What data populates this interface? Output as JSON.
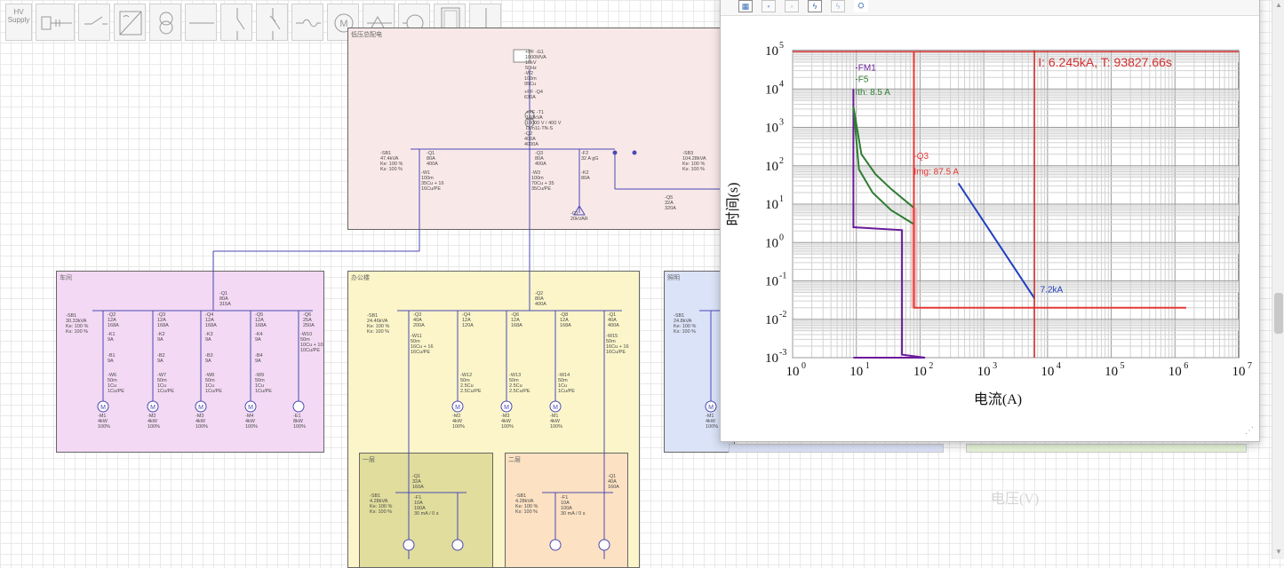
{
  "toolbar": {
    "hv_supply_label": "HV\nSupply",
    "items": [
      "hv-supply",
      "busbar",
      "disconnector",
      "converter",
      "transformer",
      "line",
      "switch",
      "breaker",
      "cable",
      "motor",
      "capacitor",
      "load",
      "panel",
      "earth"
    ]
  },
  "regions": {
    "top": {
      "title": "低压总配电"
    },
    "left": {
      "title": "车间"
    },
    "middle": {
      "title": "办公楼"
    },
    "right": {
      "title": "照明"
    },
    "sub1": {
      "title": "一层"
    },
    "sub2": {
      "title": "二层"
    }
  },
  "top_labels": {
    "source": "+PF -G1\n1000MVA\n10kV\n50Hz",
    "w2": "-W2\n100m\n95Cu",
    "q4": "+PF -Q4\n630A",
    "t1": "+PF -T1\n160kVA\n10000 V / 400 V\nDyn11-TN-S",
    "q2": "-Q2\n400A\n4000A",
    "sb1": "-SB1\n47.4kVA\nKe: 100 %\nKs: 100 %",
    "q1": "-Q1\n80A\n400A",
    "w1": "-W1\n100m\n35Cu + 16\n16Cu/PE",
    "q3": "-Q3\n80A\n400A",
    "w3": "-W3\n100m\n70Cu + 35\n35Cu/PE",
    "f2": "-F2\n32 A gG",
    "k2": "-K2\n80A",
    "c1": "-C1\n20kVAR",
    "sb3": "-SB3\n104.28kVA\nKe: 100 %\nKs: 100 %",
    "q5": "-Q5\n32A\n320A"
  },
  "left_labels": {
    "q1": "-Q1\n80A\n315A",
    "sb1": "-SB1\n30.33kVA\nKe: 100 %\nKs: 100 %",
    "feeders": [
      "-Q2\n12A\n168A",
      "-Q3\n12A\n168A",
      "-Q4\n12A\n168A",
      "-Q5\n12A\n168A",
      "-Q6\n25A\n250A"
    ],
    "contactors": [
      "-K1\n9A",
      "-K2\n9A",
      "-K3\n9A",
      "-K4\n9A"
    ],
    "relays": [
      "-B1\n9A",
      "-B2\n9A",
      "-B3\n9A",
      "-B4\n9A"
    ],
    "cables": [
      "-W6\n50m\n1Cu\n1Cu/PE",
      "-W7\n50m\n1Cu\n1Cu/PE",
      "-W8\n50m\n1Cu\n1Cu/PE",
      "-W9\n50m\n1Cu\n1Cu/PE",
      "-W10\n50m\n10Cu + 10\n10Cu/PE"
    ],
    "loads": [
      "-M1\n4kW\n100%",
      "-M2\n4kW\n100%",
      "-M3\n4kW\n100%",
      "-M4\n4kW\n100%",
      "-E1\n8kW\n100%"
    ]
  },
  "middle_labels": {
    "q2": "-Q2\n80A\n400A",
    "sb1": "-SB1\n24.46kVA\nKe: 100 %\nKs: 100 %",
    "feeders": [
      "-Q3\n40A\n200A",
      "-Q4\n12A\n120A",
      "-Q6\n12A\n168A",
      "-Q8\n12A\n168A",
      "-Q1\n40A\n400A"
    ],
    "cables": [
      "-W11\n50m\n16Cu + 16\n16Cu/PE",
      "-W12\n50m\n2.5Cu\n2.5Cu/PE",
      "-W13\n50m\n2.5Cu\n2.5Cu/PE",
      "-W14\n50m\n1Cu\n1Cu/PE",
      "-W15\n50m\n16Cu + 16\n16Cu/PE"
    ],
    "loads": [
      "-M2\n4kW\n100%",
      "-M3\n4kW\n100%",
      "-M1\n4kW\n100%"
    ]
  },
  "sub_labels": {
    "sub1_q": "-Q1\n32A\n160A",
    "sub1_sb": "-SB1\n4.28kVA\nKe: 100 %\nKs: 100 %",
    "sub1_f": "-F1\n10A\n100A\n30 mA / 0 s",
    "sub2_q": "-Q1\n40A\n160A",
    "sub2_sb": "-SB1\n4.28kVA\nKe: 100 %\nKs: 100 %",
    "sub2_f": "-F1\n10A\n100A\n30 mA / 0 s"
  },
  "right_labels": {
    "sb1": "-SB1\n24.8kVA\nKe: 100 %\nKs: 100 %",
    "load": "-M1\n4kW\n100%"
  },
  "popup": {
    "toolbar_icons": [
      "grid-icon",
      "save-icon",
      "copy-icon",
      "lightning-icon",
      "lightning-off-icon",
      "network-icon"
    ]
  },
  "chart_data": {
    "type": "line",
    "xlabel": "电流(A)",
    "ylabel": "时间(s)",
    "xscale": "log",
    "yscale": "log",
    "xlim": [
      1,
      10000000
    ],
    "ylim": [
      0.001,
      100000
    ],
    "x_ticks": [
      1,
      10,
      100,
      1000,
      10000,
      100000,
      1000000,
      10000000
    ],
    "y_ticks": [
      0.001,
      0.01,
      0.1,
      1,
      10,
      100,
      1000,
      10000,
      100000
    ],
    "grid": true,
    "cursor_readout": "I: 6.245kA, T: 93827.66s",
    "cursor": {
      "x": 6245,
      "y": 93827.66
    },
    "series": [
      {
        "color": "#6a1b9a",
        "points": [
          [
            9,
            10000
          ],
          [
            9,
            2.5
          ],
          [
            52,
            2.1
          ],
          [
            52,
            0.0012
          ],
          [
            120,
            0.001
          ],
          [
            9,
            0.001
          ]
        ]
      },
      {
        "color": "#2e7d32",
        "points": [
          [
            9,
            3500
          ],
          [
            12,
            200
          ],
          [
            20,
            60
          ],
          [
            35,
            25
          ],
          [
            80,
            8
          ]
        ]
      },
      {
        "color": "#2e7d32",
        "points": [
          [
            9,
            3500
          ],
          [
            11,
            80
          ],
          [
            18,
            20
          ],
          [
            35,
            7
          ],
          [
            80,
            3
          ]
        ]
      },
      {
        "color": "#e53935",
        "points": [
          [
            80,
            90000
          ],
          [
            80,
            0.02
          ],
          [
            1500000,
            0.02
          ]
        ]
      },
      {
        "color": "#1e3fbf",
        "points": [
          [
            400,
            35
          ],
          [
            6245,
            0.035
          ]
        ]
      }
    ],
    "labels": [
      {
        "text": "-FM1",
        "color": "#6a1b9a",
        "x": 9,
        "y": 30000
      },
      {
        "text": "-F5",
        "color": "#2e7d32",
        "x": 9,
        "y": 15000
      },
      {
        "text": "Ith: 8.5 A",
        "color": "#2e7d32",
        "x": 9,
        "y": 7000
      },
      {
        "text": "-Q3",
        "color": "#e53935",
        "x": 75,
        "y": 150
      },
      {
        "text": "Img: 87.5 A",
        "color": "#e53935",
        "x": 75,
        "y": 60
      },
      {
        "text": "7.2kA",
        "color": "#1e3fbf",
        "x": 7200,
        "y": 0.05
      }
    ]
  }
}
